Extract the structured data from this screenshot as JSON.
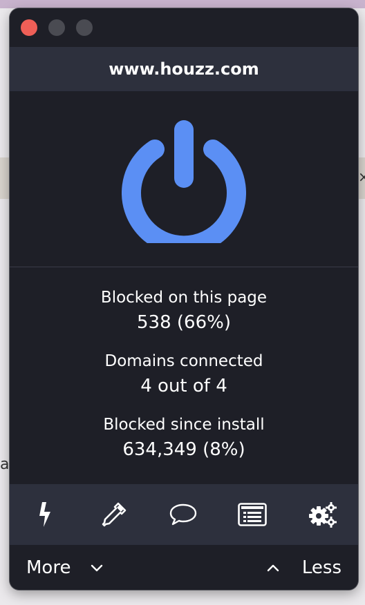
{
  "window": {
    "traffic_lights": [
      "close",
      "minimize",
      "zoom"
    ]
  },
  "header": {
    "domain": "www.houzz.com"
  },
  "power": {
    "icon": "power-icon",
    "state": "on",
    "color": "#5b8ff4"
  },
  "stats": [
    {
      "label": "Blocked on this page",
      "value": "538 (66%)"
    },
    {
      "label": "Domains connected",
      "value": "4 out of 4"
    },
    {
      "label": "Blocked since install",
      "value": "634,349 (8%)"
    }
  ],
  "toolbar": {
    "items": [
      {
        "icon": "lightning-icon"
      },
      {
        "icon": "eyedropper-icon"
      },
      {
        "icon": "speech-bubble-icon"
      },
      {
        "icon": "list-icon"
      },
      {
        "icon": "gears-icon"
      }
    ]
  },
  "footer": {
    "more_label": "More",
    "less_label": "Less"
  },
  "colors": {
    "background": "#1e1f27",
    "header_bg": "#2d303d",
    "accent": "#5b8ff4",
    "close": "#ee5f57"
  }
}
